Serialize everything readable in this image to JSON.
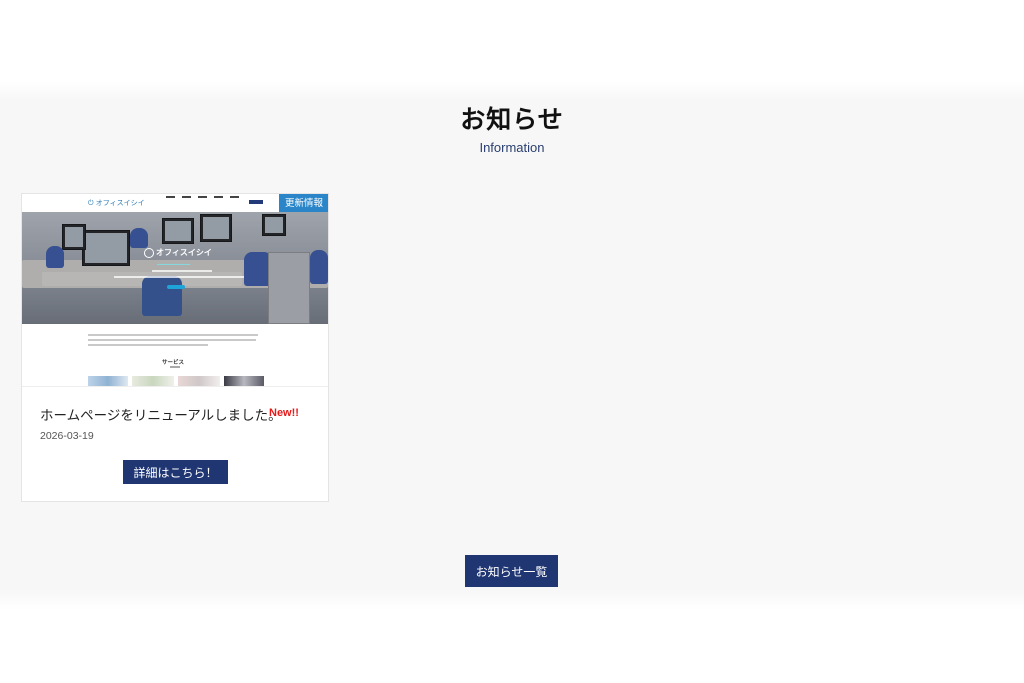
{
  "section": {
    "title": "お知らせ",
    "subtitle": "Information"
  },
  "news": [
    {
      "thumbnail": {
        "site_name": "オフィスイシイ",
        "badge": "更新情報",
        "hero_logo": "オフィスイシイ",
        "section_heading": "サービス"
      },
      "title": "ホームページをリニューアルしました。",
      "new_label": "New!!",
      "date": "2026-03-19",
      "button_label": "詳細はこちら！"
    }
  ],
  "list_button_label": "お知らせ一覧",
  "colors": {
    "button": "#1f3673",
    "new": "#e61919",
    "badge": "#2a86c9"
  }
}
